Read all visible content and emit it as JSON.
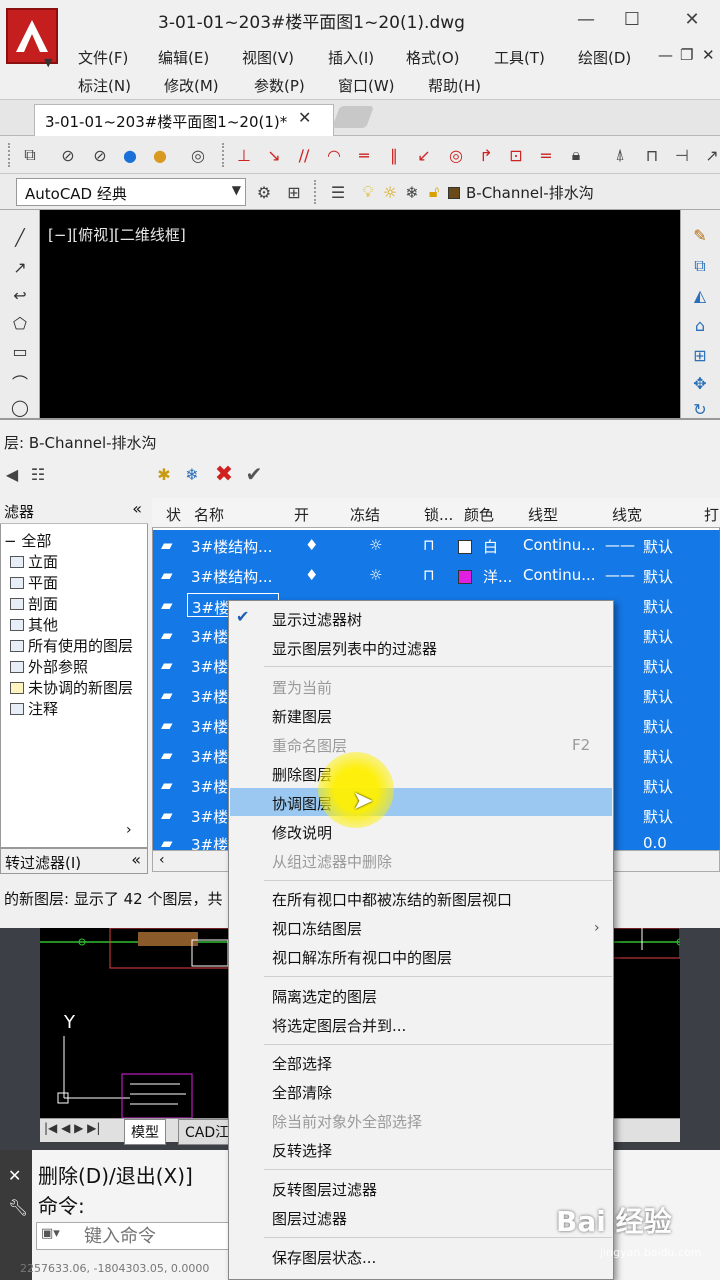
{
  "window": {
    "title": "3-01-01~203#楼平面图1~20(1).dwg",
    "minimize": "—",
    "maximize": "☐",
    "close": "✕"
  },
  "menu": {
    "row1": [
      "文件(F)",
      "编辑(E)",
      "视图(V)",
      "插入(I)",
      "格式(O)",
      "工具(T)",
      "绘图(D)"
    ],
    "row2": [
      "标注(N)",
      "修改(M)",
      "参数(P)",
      "窗口(W)",
      "帮助(H)"
    ],
    "mdi": {
      "minimize": "—",
      "restore": "❐",
      "close": "✕"
    }
  },
  "tabs": {
    "document": "3-01-01~203#楼平面图1~20(1)*",
    "close": "✕"
  },
  "toolbar": {
    "workspace": "AutoCAD 经典",
    "current_layer": "B-Channel-排水沟"
  },
  "viewport": {
    "label": "[−][俯视][二维线框]"
  },
  "layer_panel": {
    "title": "层: B-Channel-排水沟",
    "filter_header": "滤器",
    "filters": [
      "全部",
      "立面",
      "平面",
      "剖面",
      "其他",
      "所有使用的图层",
      "外部参照",
      "未协调的新图层",
      "注释"
    ],
    "invert_filter": "转过滤器(I)",
    "columns": [
      "状",
      "名称",
      "开",
      "冻结",
      "锁...",
      "颜色",
      "线型",
      "线宽",
      "打"
    ],
    "rows": [
      {
        "name": "3#楼结构...",
        "color": "白",
        "color_hex": "#ffffff",
        "linetype": "Continu...",
        "lineweight": "默认"
      },
      {
        "name": "3#楼结构...",
        "color": "洋...",
        "color_hex": "#e020e0",
        "linetype": "Continu...",
        "lineweight": "默认"
      },
      {
        "name": "3#楼结构...",
        "lineweight": "默认"
      },
      {
        "name": "3#楼",
        "lineweight": "默认"
      },
      {
        "name": "3#楼",
        "lineweight": "默认"
      },
      {
        "name": "3#楼",
        "lineweight": "默认"
      },
      {
        "name": "3#楼",
        "lineweight": "默认"
      },
      {
        "name": "3#楼",
        "lineweight": "默认"
      },
      {
        "name": "3#楼",
        "lineweight": "默认"
      },
      {
        "name": "3#楼",
        "lineweight": "默认"
      },
      {
        "name": "3#楼",
        "lineweight": "0.0"
      }
    ],
    "status": "的新图层: 显示了 42 个图层，共"
  },
  "context_menu": {
    "items": [
      {
        "label": "显示过滤器树",
        "checked": true,
        "disabled": false
      },
      {
        "label": "显示图层列表中的过滤器",
        "disabled": false
      },
      {
        "label": "置为当前",
        "disabled": true
      },
      {
        "label": "新建图层",
        "disabled": false
      },
      {
        "label": "重命名图层",
        "disabled": true,
        "shortcut": "F2"
      },
      {
        "label": "删除图层",
        "disabled": false
      },
      {
        "label": "协调图层",
        "disabled": false,
        "highlighted": true
      },
      {
        "label": "修改说明",
        "disabled": false
      },
      {
        "label": "从组过滤器中删除",
        "disabled": true
      },
      {
        "label": "在所有视口中都被冻结的新图层视口",
        "disabled": false
      },
      {
        "label": "视口冻结图层",
        "disabled": false,
        "submenu": true
      },
      {
        "label": "视口解冻所有视口中的图层",
        "disabled": false
      },
      {
        "label": "隔离选定的图层",
        "disabled": false
      },
      {
        "label": "将选定图层合并到...",
        "disabled": false
      },
      {
        "label": "全部选择",
        "disabled": false
      },
      {
        "label": "全部清除",
        "disabled": false
      },
      {
        "label": "除当前对象外全部选择",
        "disabled": true
      },
      {
        "label": "反转选择",
        "disabled": false
      },
      {
        "label": "反转图层过滤器",
        "disabled": false
      },
      {
        "label": "图层过滤器",
        "disabled": false
      },
      {
        "label": "保存图层状态...",
        "disabled": false
      }
    ]
  },
  "model_tabs": {
    "model": "模型",
    "layout": "CAD江"
  },
  "command": {
    "history": "删除(D)/退出(X)]",
    "prompt": "命令:",
    "placeholder": "键入命令",
    "coords": "2257633.06, -1804303.05, 0.0000"
  },
  "watermark": {
    "text": "Bai 经验",
    "sub": "jingyan.baidu.com"
  }
}
